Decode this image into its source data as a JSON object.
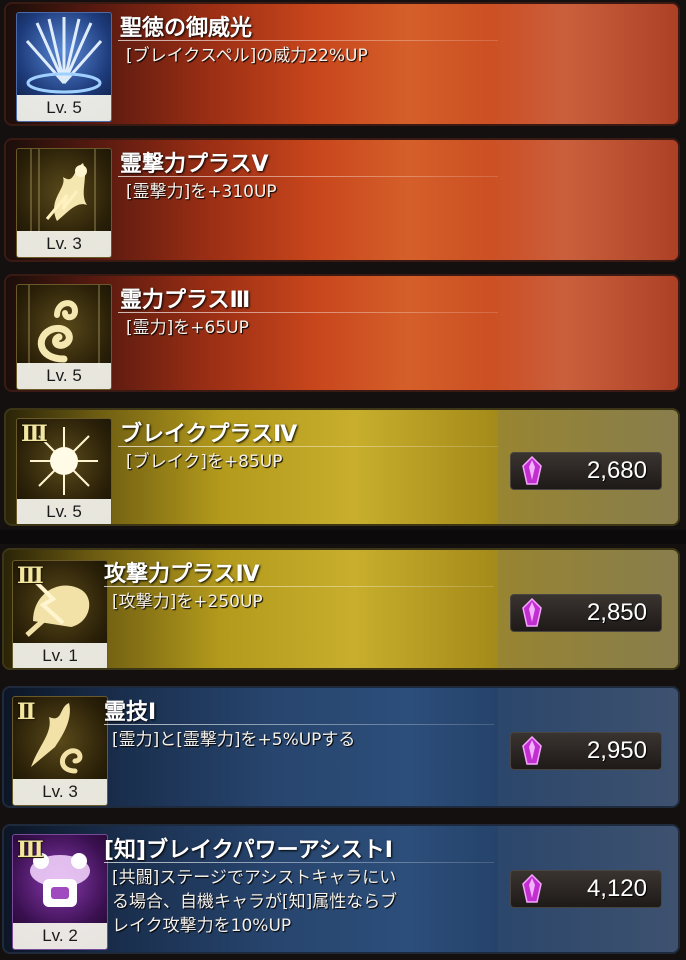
{
  "skills": [
    {
      "style": "red",
      "icon": "holy-light-rays-icon",
      "roman": "",
      "level": "Lv. 5",
      "title": "聖徳の御威光",
      "desc": [
        "[ブレイクスペル]の威力22%UP"
      ],
      "cost": null
    },
    {
      "style": "red",
      "icon": "spirit-strike-flame-icon",
      "roman": "",
      "level": "Lv. 3",
      "title": "霊撃力プラスⅤ",
      "desc": [
        "[霊撃力]を+310UP"
      ],
      "cost": null
    },
    {
      "style": "red",
      "icon": "spirit-swirl-icon",
      "roman": "",
      "level": "Lv. 5",
      "title": "霊力プラスⅢ",
      "desc": [
        "[霊力]を+65UP"
      ],
      "cost": null
    },
    {
      "style": "gold",
      "icon": "burst-star-icon",
      "roman": "Ⅲ",
      "level": "Lv. 5",
      "title": "ブレイクプラスⅣ",
      "desc": [
        "[ブレイク]を+85UP"
      ],
      "cost": "2,680"
    },
    {
      "style": "gold",
      "icon": "crack-fist-icon",
      "roman": "Ⅲ",
      "level": "Lv. 1",
      "title": "攻撃力プラスⅣ",
      "desc": [
        "[攻撃力]を+250UP"
      ],
      "cost": "2,850"
    },
    {
      "style": "blue",
      "icon": "spirit-technique-icon",
      "roman": "Ⅱ",
      "level": "Lv. 3",
      "title": "霊技Ⅰ",
      "desc": [
        "[霊力]と[霊撃力]を+5%UPする"
      ],
      "cost": "2,950"
    },
    {
      "style": "blue",
      "icon": "assist-characters-icon",
      "roman": "Ⅲ",
      "level": "Lv. 2",
      "title": "[知]ブレイクパワーアシストⅠ",
      "desc": [
        "[共闘]ステージでアシストキャラにい",
        "る場合、自機キャラが[知]属性ならブ",
        "レイク攻撃力を10%UP"
      ],
      "cost": "4,120"
    }
  ],
  "colors": {
    "gem": "#d03ad8",
    "gem_light": "#f6a6ff"
  }
}
